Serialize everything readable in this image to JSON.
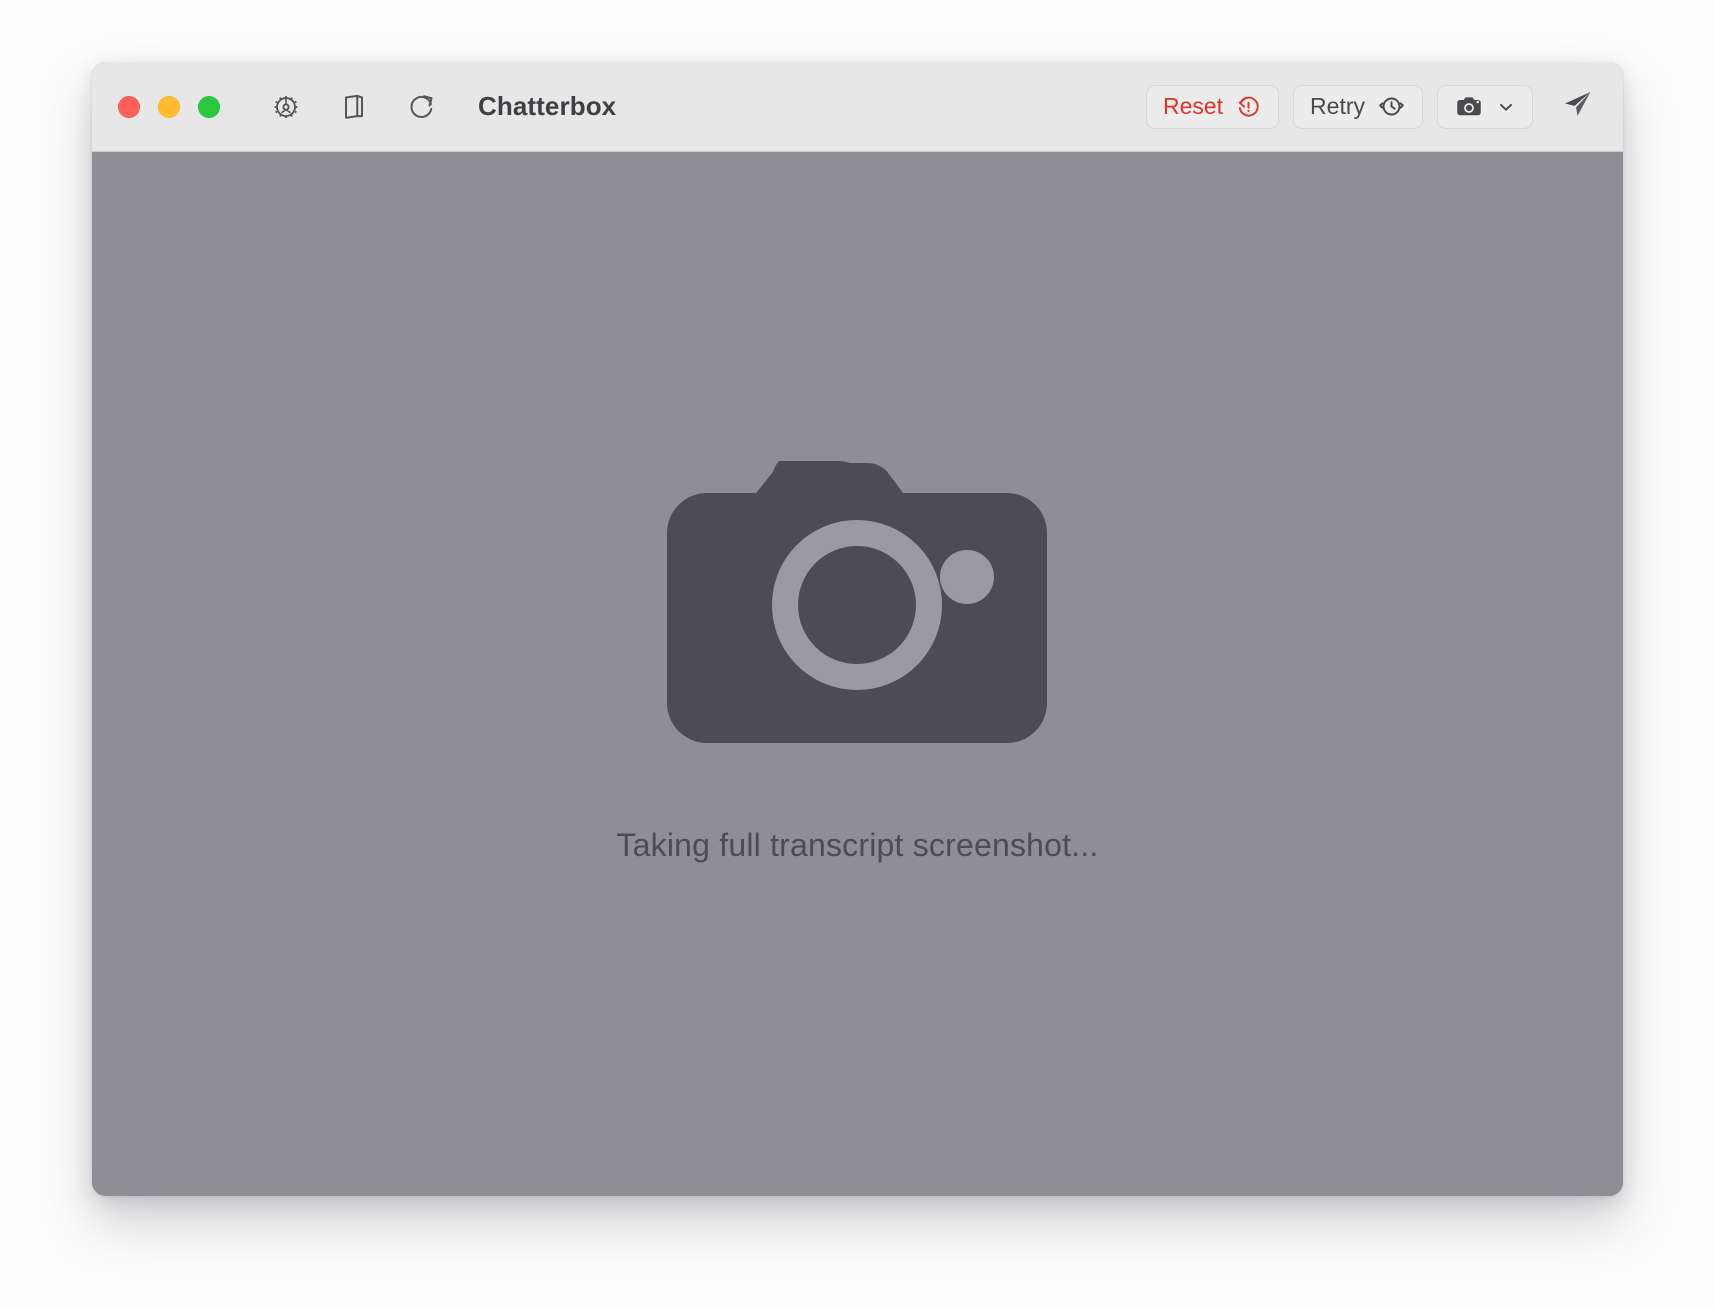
{
  "window": {
    "title": "Chatterbox",
    "traffic_lights": [
      {
        "name": "close",
        "color": "#ff5f57"
      },
      {
        "name": "minimize",
        "color": "#febc2e"
      },
      {
        "name": "zoom",
        "color": "#28c840"
      }
    ]
  },
  "toolbar": {
    "left_icons": [
      {
        "name": "gear-icon",
        "label": "Settings"
      },
      {
        "name": "sidebar-icon",
        "label": "Toggle Sidebar"
      },
      {
        "name": "refresh-icon",
        "label": "Reload"
      }
    ],
    "reset_label": "Reset",
    "reset_color": "#e0342b",
    "retry_label": "Retry",
    "camera_label": "",
    "send_label": ""
  },
  "main": {
    "status_text": "Taking full transcript screenshot...",
    "glyph": "camera-icon",
    "background_color": "#8e8e94",
    "glyph_body_color": "#4c4c52",
    "glyph_accent_color": "#9a9aa0"
  }
}
